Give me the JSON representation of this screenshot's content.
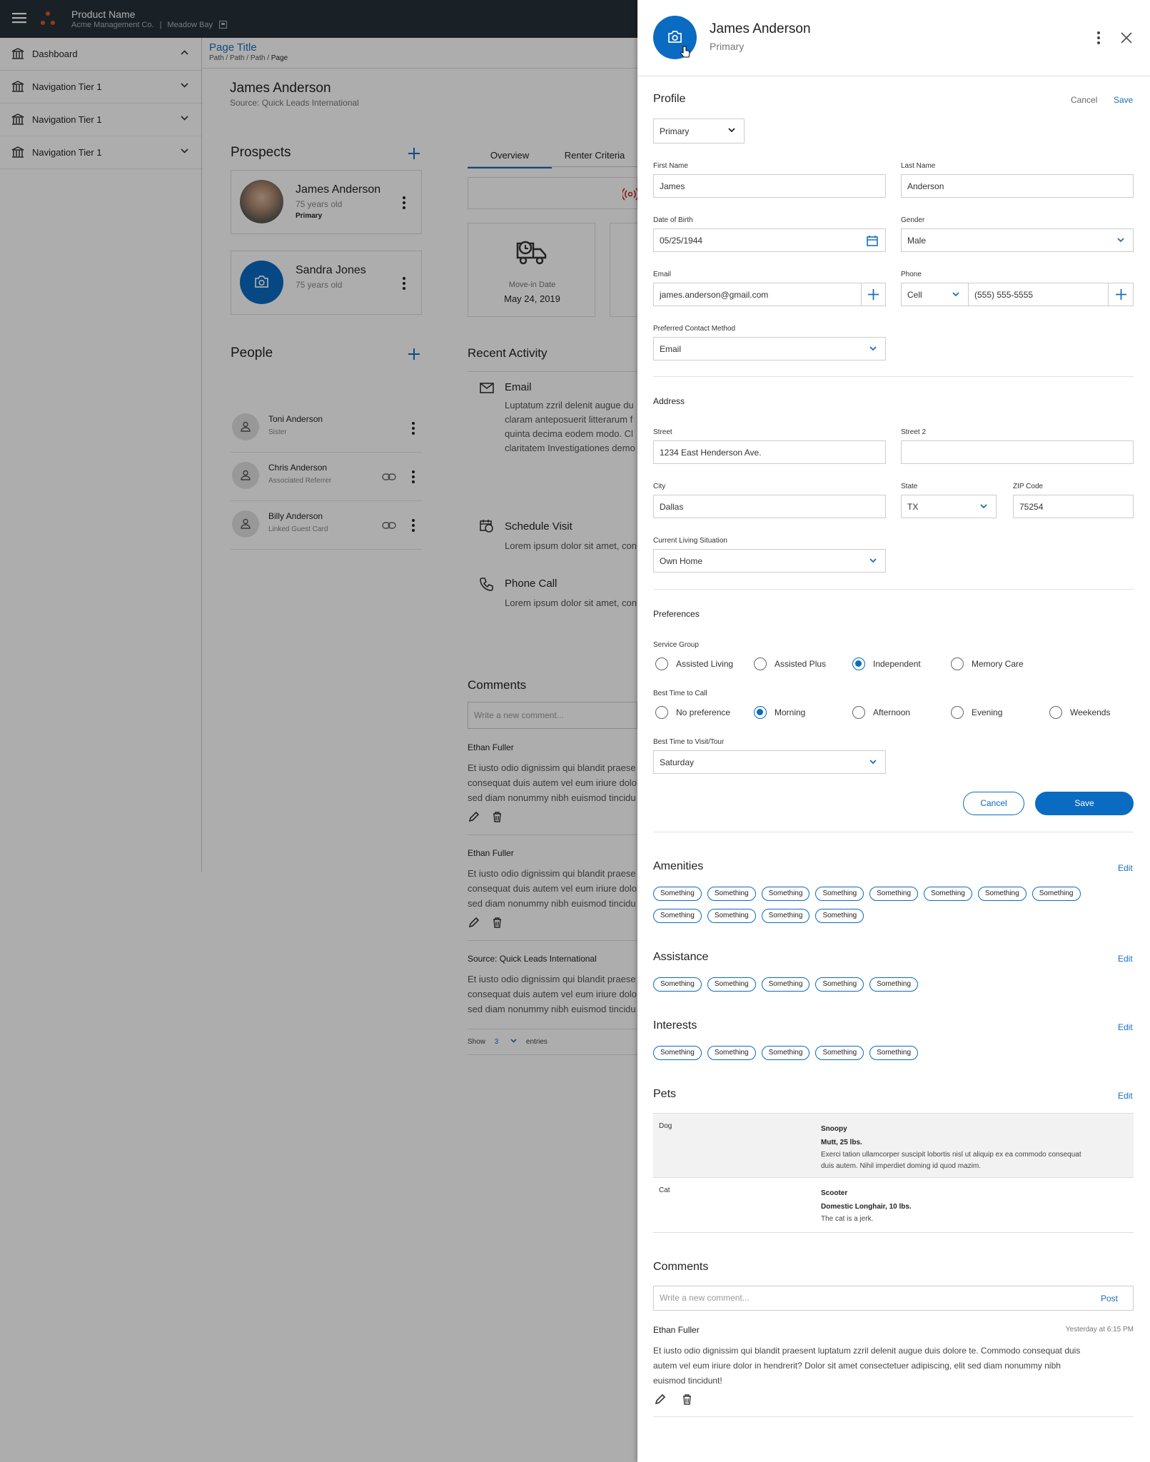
{
  "topbar": {
    "product_name": "Product Name",
    "company": "Acme Management Co.",
    "separator": "|",
    "location": "Meadow Bay"
  },
  "sidebar": {
    "items": [
      {
        "label": "Dashboard"
      },
      {
        "label": "Navigation Tier 1"
      },
      {
        "label": "Navigation Tier 1"
      },
      {
        "label": "Navigation Tier 1"
      }
    ]
  },
  "main": {
    "page_title": "Page Title",
    "breadcrumb": [
      "Path",
      "/",
      "Path",
      "/",
      "Path",
      "/",
      "Page"
    ],
    "lead_name": "James Anderson",
    "lead_source": "Source: Quick Leads International",
    "prospects_title": "Prospects",
    "prospects": [
      {
        "name": "James Anderson",
        "age": "75 years old",
        "tag": "Primary"
      },
      {
        "name": "Sandra Jones",
        "age": "75 years old"
      }
    ],
    "people_title": "People",
    "people": [
      {
        "name": "Toni Anderson",
        "relation": "Sister"
      },
      {
        "name": "Chris Anderson",
        "relation": "Associated Referrer"
      },
      {
        "name": "Billy Anderson",
        "relation": "Linked Guest Card"
      }
    ],
    "tabs": [
      "Overview",
      "Renter Criteria"
    ],
    "move_in_label": "Move-in Date",
    "move_in_date": "May 24, 2019",
    "recent_activity_title": "Recent Activity",
    "activities": [
      {
        "title": "Email",
        "body": [
          "Luptatum zzril delenit augue du",
          "claram anteposuerit litterarum f",
          "quinta decima eodem modo. Cl",
          "claritatem Investigationes demo"
        ]
      },
      {
        "title": "Schedule Visit",
        "body": [
          "Lorem ipsum dolor sit amet, con"
        ]
      },
      {
        "title": "Phone Call",
        "body": [
          "Lorem ipsum dolor sit amet, con"
        ]
      }
    ],
    "comments_title": "Comments",
    "comment_placeholder": "Write a new comment...",
    "comments": [
      {
        "author": "Ethan Fuller",
        "body": [
          "Et iusto odio dignissim qui blandit praese",
          "consequat duis autem vel eum iriure dolo",
          "sed diam nonummy nibh euismod tincidu"
        ]
      },
      {
        "author": "Ethan Fuller",
        "body": [
          "Et iusto odio dignissim qui blandit praese",
          "consequat duis autem vel eum iriure dolo",
          "sed diam nonummy nibh euismod tincidu"
        ]
      },
      {
        "author": "Source: Quick Leads International",
        "body": [
          "Et iusto odio dignissim qui blandit praese",
          "consequat duis autem vel eum iriure dolo",
          "sed diam nonummy nibh euismod tincidu"
        ]
      }
    ],
    "show_label": "Show",
    "show_value": "3",
    "entries_label": "entries"
  },
  "drawer": {
    "name": "James Anderson",
    "type": "Primary",
    "profile_title": "Profile",
    "cancel_label": "Cancel",
    "save_label": "Save",
    "profile_type": "Primary",
    "first_name_label": "First Name",
    "first_name": "James",
    "last_name_label": "Last Name",
    "last_name": "Anderson",
    "dob_label": "Date of Birth",
    "dob": "05/25/1944",
    "gender_label": "Gender",
    "gender": "Male",
    "email_label": "Email",
    "email": "james.anderson@gmail.com",
    "phone_label": "Phone",
    "phone_type": "Cell",
    "phone": "(555) 555-5555",
    "contact_method_label": "Preferred Contact Method",
    "contact_method": "Email",
    "address_title": "Address",
    "street_label": "Street",
    "street": "1234 East Henderson Ave.",
    "street2_label": "Street 2",
    "street2": "",
    "city_label": "City",
    "city": "Dallas",
    "state_label": "State",
    "state": "TX",
    "zip_label": "ZIP Code",
    "zip": "75254",
    "living_label": "Current Living Situation",
    "living": "Own Home",
    "preferences_title": "Preferences",
    "service_group_label": "Service Group",
    "service_groups": [
      {
        "label": "Assisted Living",
        "checked": false
      },
      {
        "label": "Assisted Plus",
        "checked": false
      },
      {
        "label": "Independent",
        "checked": true
      },
      {
        "label": "Memory Care",
        "checked": false
      }
    ],
    "best_time_call_label": "Best Time to Call",
    "best_times": [
      {
        "label": "No preference",
        "checked": false
      },
      {
        "label": "Morning",
        "checked": true
      },
      {
        "label": "Afternoon",
        "checked": false
      },
      {
        "label": "Evening",
        "checked": false
      },
      {
        "label": "Weekends",
        "checked": false
      }
    ],
    "best_time_visit_label": "Best Time to Visit/Tour",
    "best_time_visit": "Saturday",
    "edit_label": "Edit",
    "amenities_title": "Amenities",
    "amenities": [
      "Something",
      "Something",
      "Something",
      "Something",
      "Something",
      "Something",
      "Something",
      "Something",
      "Something",
      "Something",
      "Something",
      "Something"
    ],
    "assistance_title": "Assistance",
    "assistance": [
      "Something",
      "Something",
      "Something",
      "Something",
      "Something"
    ],
    "interests_title": "Interests",
    "interests": [
      "Something",
      "Something",
      "Something",
      "Something",
      "Something"
    ],
    "pets_title": "Pets",
    "pets": [
      {
        "kind": "Dog",
        "name": "Snoopy",
        "detail": "Mutt, 25 lbs.",
        "notes": [
          "Exerci tation ullamcorper suscipit lobortis nisl ut aliquip ex ea commodo consequat",
          "duis autem. Nihil imperdiet doming id quod mazim."
        ]
      },
      {
        "kind": "Cat",
        "name": "Scooter",
        "detail": "Domestic Longhair, 10 lbs.",
        "notes": [
          "The cat is a jerk."
        ]
      }
    ],
    "comments_title": "Comments",
    "comment_placeholder": "Write a new comment...",
    "post_label": "Post",
    "comment_author": "Ethan Fuller",
    "comment_time": "Yesterday at 6:15 PM",
    "comment_body": [
      "Et iusto odio dignissim qui blandit praesent luptatum zzril delenit augue duis dolore te. Commodo consequat duis",
      "autem vel eum iriure dolor in hendrerit? Dolor sit amet consectetuer adipiscing, elit sed diam nonummy nibh",
      "euismod tincidunt!"
    ]
  },
  "colors": {
    "accent": "#0a6bc2",
    "topbar": "#263238",
    "logo": "#e2541f"
  },
  "icons": [
    "menu-icon",
    "building-icon",
    "plus-icon",
    "kebab-icon",
    "person-icon",
    "link-icon",
    "camera-icon",
    "close-icon",
    "calendar-icon",
    "chevron-down-icon",
    "mail-icon",
    "phone-icon",
    "edit-icon",
    "trash-icon"
  ]
}
